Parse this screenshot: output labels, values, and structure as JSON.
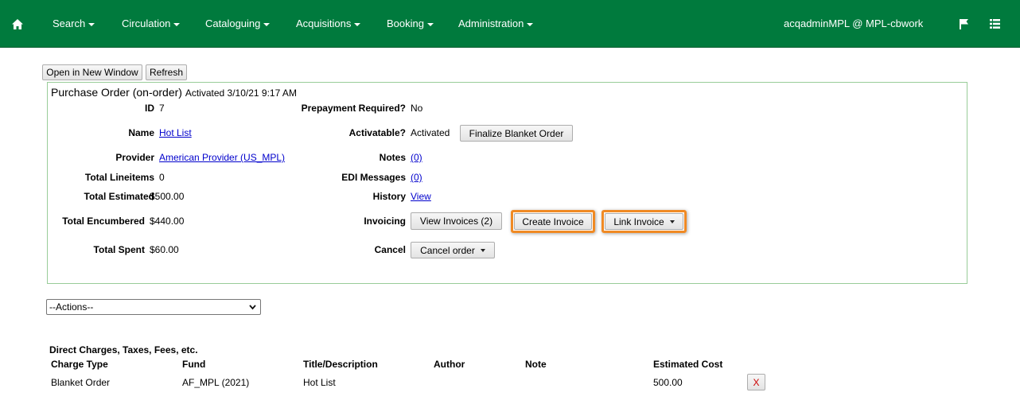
{
  "nav": {
    "menus": [
      {
        "label": "Search",
        "has_caret": true
      },
      {
        "label": "Circulation",
        "has_caret": true
      },
      {
        "label": "Cataloguing",
        "has_caret": true
      },
      {
        "label": "Acquisitions",
        "has_caret": true
      },
      {
        "label": "Booking",
        "has_caret": true
      },
      {
        "label": "Administration",
        "has_caret": true
      }
    ],
    "user": "acqadminMPL @ MPL-cbwork",
    "icons": [
      "home-icon",
      "flag-icon",
      "list-icon"
    ],
    "bg_color": "#007a3d"
  },
  "toolbar": {
    "open_new_window": "Open in New Window",
    "refresh": "Refresh"
  },
  "po": {
    "heading": "Purchase Order (on-order)",
    "activated": "Activated 3/10/21 9:17 AM",
    "left": {
      "id_label": "ID",
      "id_value": "7",
      "name_label": "Name",
      "name_value": "Hot List",
      "provider_label": "Provider",
      "provider_value": "American Provider (US_MPL)",
      "lineitems_label": "Total Lineitems",
      "lineitems_value": "0",
      "estimated_label": "Total Estimated",
      "estimated_value": "$500.00",
      "encumbered_label": "Total Encumbered",
      "encumbered_value": "$440.00",
      "spent_label": "Total Spent",
      "spent_value": "$60.00"
    },
    "right": {
      "prepay_label": "Prepayment Required?",
      "prepay_value": "No",
      "activatable_label": "Activatable?",
      "activatable_value": "Activated",
      "finalize_button": "Finalize Blanket Order",
      "notes_label": "Notes",
      "notes_value": "(0)",
      "edi_label": "EDI Messages",
      "edi_value": "(0)",
      "history_label": "History",
      "history_value": "View",
      "invoicing_label": "Invoicing",
      "view_invoices": "View Invoices (2)",
      "create_invoice": "Create Invoice",
      "link_invoice": "Link Invoice",
      "cancel_label": "Cancel",
      "cancel_order": "Cancel order"
    },
    "highlight_color": "#f08a24"
  },
  "actions": {
    "selected": "--Actions--"
  },
  "charges": {
    "heading": "Direct Charges, Taxes, Fees, etc.",
    "columns": [
      "Charge Type",
      "Fund",
      "Title/Description",
      "Author",
      "Note",
      "Estimated Cost"
    ],
    "rows": [
      {
        "charge_type": "Blanket Order",
        "fund": "AF_MPL (2021)",
        "title": "Hot List",
        "author": "",
        "note": "",
        "cost": "500.00",
        "delete": "X"
      }
    ]
  }
}
